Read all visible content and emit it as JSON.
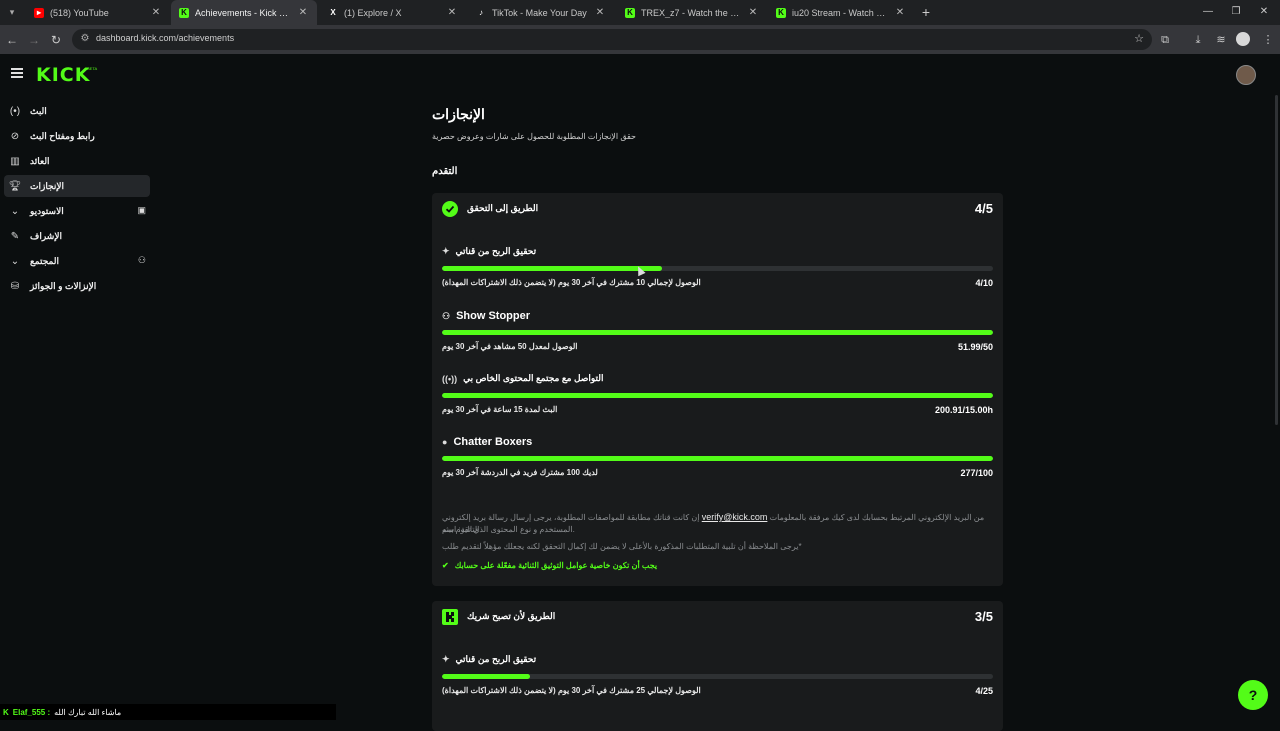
{
  "browser": {
    "tabs": [
      {
        "title": "(518) YouTube",
        "favicon": "youtube-icon",
        "active": false
      },
      {
        "title": "Achievements - Kick Dashboard",
        "favicon": "kick-icon",
        "active": true
      },
      {
        "title": "(1) Explore / X",
        "favicon": "x-icon",
        "active": false
      },
      {
        "title": "TikTok - Make Your Day",
        "favicon": "tiktok-icon",
        "active": false
      },
      {
        "title": "TREX_z7 - Watch the VOD on Ki",
        "favicon": "kick-icon",
        "active": false
      },
      {
        "title": "iu20 Stream - Watch Live on Ki",
        "favicon": "kick-icon",
        "active": false
      }
    ],
    "url": "dashboard.kick.com/achievements"
  },
  "header": {
    "logo_text": "KICK",
    "logo_badge": "BETA"
  },
  "sidebar": {
    "items": [
      {
        "label": "البث",
        "icon": "broadcast-icon"
      },
      {
        "label": "رابط ومفتاح البث",
        "icon": "link-icon"
      },
      {
        "label": "العائد",
        "icon": "chart-icon"
      },
      {
        "label": "الإنجازات",
        "icon": "trophy-icon"
      },
      {
        "label": "الاستوديو",
        "icon": "studio-icon"
      },
      {
        "label": "الإشراف",
        "icon": "wrench-icon"
      },
      {
        "label": "المجتمع",
        "icon": "community-icon"
      },
      {
        "label": "الإنزالات و الجوائز",
        "icon": "gift-icon"
      }
    ]
  },
  "main": {
    "title": "الإنجازات",
    "subtitle": "حقق الإنجازات المطلوبة للحصول على شارات وعروض حصرية",
    "progress_heading": "التقدم",
    "verify_card": {
      "title": "الطريق إلى التحقق",
      "count": "4/5",
      "achievements": [
        {
          "name": "تحقيق الربح من قناتي",
          "desc": "الوصول لإجمالي 10 مشترك في آخر 30 يوم (لا يتضمن ذلك الاشتراكات المهداة)",
          "value": "4/10",
          "progress": 0.4
        },
        {
          "name": "Show Stopper",
          "desc": "الوصول لمعدل 50 مشاهد في آخر 30 يوم",
          "value": "51.99/50",
          "progress": 1.0
        },
        {
          "name": "التواصل مع مجتمع المحتوى الخاص بي",
          "desc": "البث لمدة 15 ساعة في آخر 30 يوم",
          "value": "200.91/15.00h",
          "progress": 1.0
        },
        {
          "name": "Chatter Boxers",
          "desc": "لديك 100 مشترك فريد في الدردشة آخر 30 يوم",
          "value": "277/100",
          "progress": 1.0
        }
      ],
      "note_line1_a": "إن كانت قناتك مطابقة للمواصفات المطلوبة، يرجى إرسال رسالة بريد إلكتروني",
      "note_email": "verify@kick.com",
      "note_line1_b": "من البريد الإلكتروني المرتبط بحسابك لدى كيك مرفقة بالمعلومات التالية: اسم",
      "note_line2": "المستخدم و نوع المحتوى الذي تقوم ببثه.",
      "note_line3": "يرجى الملاحظة أن تلبية المتطلبات المذكورة بالأعلى لا يضمن لك إكمال التحقق لكنه يجعلك مؤهلاً لتقديم طلب*",
      "requirement": "يجب أن تكون خاصية عوامل التوثيق الثنائية مفعّلة على حسابك"
    },
    "partner_card": {
      "title": "الطريق لأن تصبح شريك",
      "count": "3/5",
      "achievements": [
        {
          "name": "تحقيق الربح من قناتي",
          "desc": "الوصول لإجمالي 25 مشترك في آخر 30 يوم (لا يتضمن ذلك الاشتراكات المهداة)",
          "value": "4/25",
          "progress": 0.16
        }
      ]
    }
  },
  "chat_overlay": {
    "user": "Elaf_555 :",
    "message": "ماشاء الله تبارك الله"
  },
  "colors": {
    "accent": "#53fc18",
    "background": "#0b0e0f",
    "card": "#191b1c"
  }
}
